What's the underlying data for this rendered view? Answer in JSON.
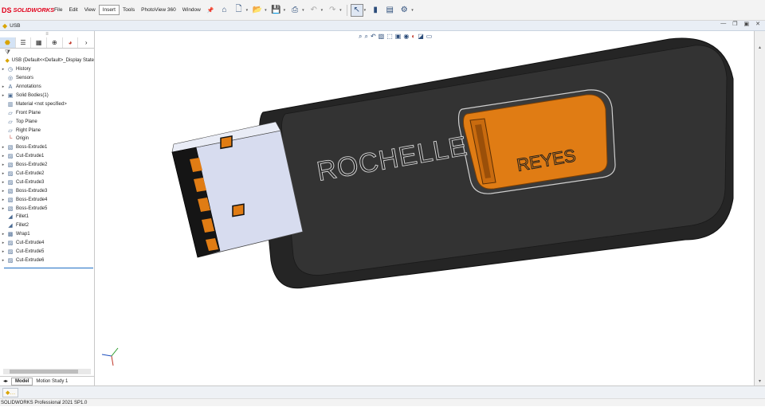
{
  "app": {
    "logo_ds": "DS",
    "brand": "SOLIDWORKS",
    "menus": [
      "File",
      "Edit",
      "View",
      "Insert",
      "Tools",
      "PhotoView 360",
      "Window"
    ]
  },
  "document": {
    "title": "USB"
  },
  "feature_tree": {
    "root": "USB  (Default<<Default>_Display State",
    "items": [
      {
        "label": "History",
        "icon": "history-icon",
        "expandable": true
      },
      {
        "label": "Sensors",
        "icon": "sensor-icon",
        "expandable": false
      },
      {
        "label": "Annotations",
        "icon": "annotation-icon",
        "expandable": true
      },
      {
        "label": "Solid Bodies(1)",
        "icon": "solid-body-icon",
        "expandable": true
      },
      {
        "label": "Material <not specified>",
        "icon": "material-icon",
        "expandable": false
      },
      {
        "label": "Front Plane",
        "icon": "plane-icon",
        "expandable": false
      },
      {
        "label": "Top Plane",
        "icon": "plane-icon",
        "expandable": false
      },
      {
        "label": "Right Plane",
        "icon": "plane-icon",
        "expandable": false
      },
      {
        "label": "Origin",
        "icon": "origin-icon",
        "expandable": false
      },
      {
        "label": "Boss-Extrude1",
        "icon": "extrude-icon",
        "expandable": true
      },
      {
        "label": "Cut-Extrude1",
        "icon": "cut-icon",
        "expandable": true
      },
      {
        "label": "Boss-Extrude2",
        "icon": "extrude-icon",
        "expandable": true
      },
      {
        "label": "Cut-Extrude2",
        "icon": "cut-icon",
        "expandable": true
      },
      {
        "label": "Cut-Extrude3",
        "icon": "cut-icon",
        "expandable": true
      },
      {
        "label": "Boss-Extrude3",
        "icon": "extrude-icon",
        "expandable": true
      },
      {
        "label": "Boss-Extrude4",
        "icon": "extrude-icon",
        "expandable": true
      },
      {
        "label": "Boss-Extrude5",
        "icon": "extrude-icon",
        "expandable": true
      },
      {
        "label": "Fillet1",
        "icon": "fillet-icon",
        "expandable": false
      },
      {
        "label": "Fillet2",
        "icon": "fillet-icon",
        "expandable": false
      },
      {
        "label": "Wrap1",
        "icon": "wrap-icon",
        "expandable": true
      },
      {
        "label": "Cut-Extrude4",
        "icon": "cut-icon",
        "expandable": true
      },
      {
        "label": "Cut-Extrude5",
        "icon": "cut-icon",
        "expandable": true
      },
      {
        "label": "Cut-Extrude6",
        "icon": "cut-icon",
        "expandable": true
      }
    ]
  },
  "bottom_tabs": {
    "model": "Model",
    "motion": "Motion Study 1"
  },
  "model": {
    "text_left": "ROCHELLE",
    "text_slider": "REYES",
    "body_color": "#2e2e2e",
    "accent_color": "#e07c14",
    "plug_color": "#d7dcef"
  },
  "status": {
    "text": "SOLIDWORKS Professional 2021 SP1.0"
  }
}
